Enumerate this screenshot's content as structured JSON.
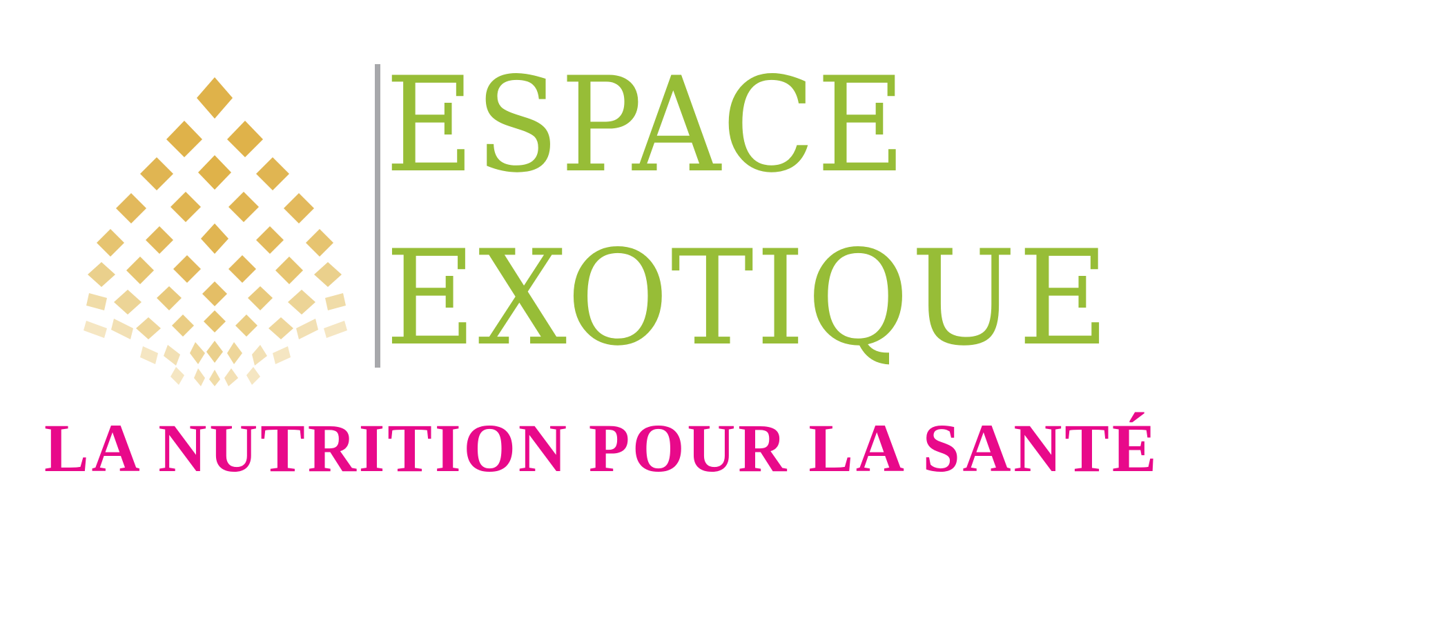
{
  "logo": {
    "name_line_1": "ESPACE",
    "name_line_2": "EXOTIQUE",
    "tagline": "LA NUTRITION POUR LA SANTÉ",
    "emblem_icon": "golden-diamond-grid-icon"
  },
  "colors": {
    "brand_green": "#97bd37",
    "tagline_pink": "#e8098a",
    "emblem_gold": "#dfb24a",
    "emblem_gold_light": "#f3e0b4",
    "divider_gray": "#a7a8ab",
    "background": "#ffffff"
  }
}
